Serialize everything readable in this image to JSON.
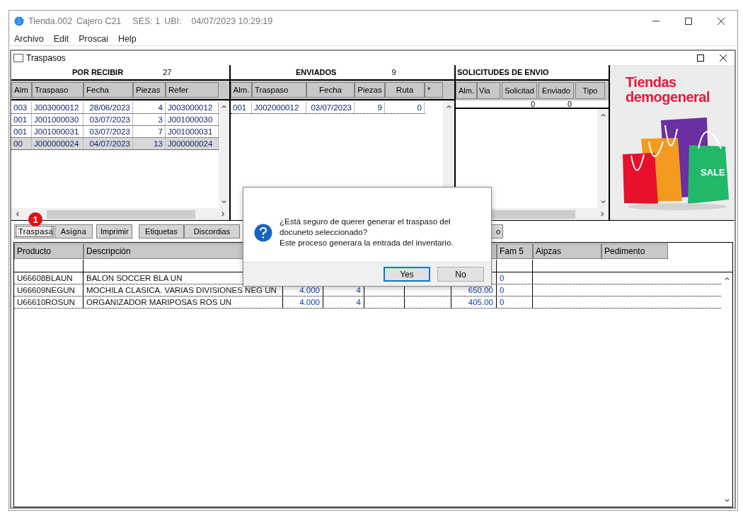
{
  "window": {
    "title": "Tienda.002",
    "cashier": "Cajero C21",
    "session": "SES: 1",
    "location": "UBI:",
    "datetime": "04/07/2023 10:29:19"
  },
  "menu": [
    "Archivo",
    "Edit",
    "Proscai",
    "Help"
  ],
  "child_window": {
    "title": "Traspasos"
  },
  "por_recibir": {
    "title": "POR RECIBIR",
    "count": "27",
    "columns": [
      "Alm",
      "Traspaso",
      "Fecha",
      "Piezas",
      "Refer"
    ],
    "rows": [
      {
        "cells": [
          "003",
          "J003000012",
          "28/06/2023",
          "4",
          "J003000012"
        ],
        "selected": false
      },
      {
        "cells": [
          "001",
          "J001000030",
          "03/07/2023",
          "3",
          "J001000030"
        ],
        "selected": false
      },
      {
        "cells": [
          "001",
          "J001000031",
          "03/07/2023",
          "7",
          "J001000031"
        ],
        "selected": false
      },
      {
        "cells": [
          "00",
          "J000000024",
          "04/07/2023",
          "13",
          "J000000024"
        ],
        "selected": true
      }
    ]
  },
  "enviados": {
    "title": "ENVIADOS",
    "count": "9",
    "columns": [
      "Alm.",
      "Traspaso",
      "Fecha",
      "Piezas",
      "Ruta",
      "*"
    ],
    "rows": [
      {
        "cells": [
          "001",
          "J002000012",
          "03/07/2023",
          "9",
          "0"
        ],
        "selected": false
      }
    ]
  },
  "solicitudes": {
    "title": "SOLICITUDES DE ENVIO",
    "columns": [
      "Alm.",
      "Via",
      "Solicitad",
      "Enviado",
      "Tipo"
    ],
    "totals": [
      "0",
      "0"
    ]
  },
  "banner": {
    "kind": "picture",
    "title": "Tiendas demogeneral",
    "tag": "SALE"
  },
  "toolbar": {
    "badge": "1",
    "buttons": [
      {
        "label": "Traspasa",
        "selected": true
      },
      {
        "label": "Asigna",
        "selected": false
      },
      {
        "label": "Imprimir",
        "selected": false
      },
      {
        "label": "Etiquetas",
        "selected": false
      },
      {
        "label": "Discordias",
        "selected": false
      },
      {
        "label": "o",
        "selected": false
      }
    ]
  },
  "detail": {
    "columns": [
      "Producto",
      "Descripción",
      "Fam 5",
      "Aipzas",
      "Pedimento"
    ],
    "rows": [
      {
        "producto": "U66608BLAUN",
        "descripcion": "BALON SOCCER BLA UN",
        "fam_5": "0"
      },
      {
        "producto": "U66609NEGUN",
        "descripcion": "MOCHILA CLASICA. VARIAS DIVISIONES NEG UN",
        "column_3": "4.000",
        "column_4": "4",
        "column_7": "650.00",
        "fam_5": "0"
      },
      {
        "producto": "U66610ROSUN",
        "descripcion": "ORGANIZADOR MARIPOSAS ROS UN",
        "column_3": "4.000",
        "column_4": "4",
        "column_7": "405.00",
        "fam_5": "0"
      }
    ]
  },
  "dialog": {
    "message": "¿Está seguro de querer generar el traspaso del\ndocuneto seleccionado?\nEste proceso generara la entrada del inventario.",
    "buttons": [
      {
        "label": "Yes",
        "default": true
      },
      {
        "label": "No",
        "default": false
      }
    ]
  }
}
